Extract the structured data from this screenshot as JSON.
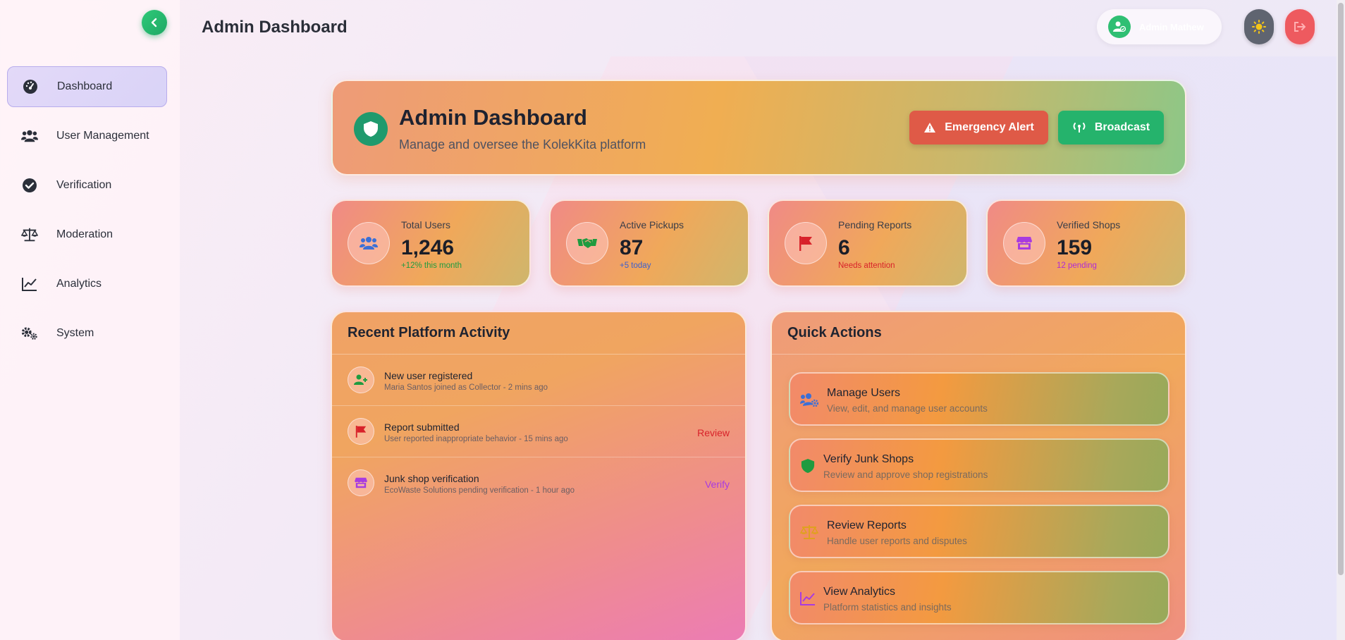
{
  "header": {
    "title": "Admin Dashboard",
    "user_name": "Admin Mathew"
  },
  "sidebar": {
    "items": [
      {
        "label": "Dashboard",
        "icon": "dashboard-gauge-icon",
        "active": true
      },
      {
        "label": "User Management",
        "icon": "users-icon",
        "active": false
      },
      {
        "label": "Verification",
        "icon": "check-circle-icon",
        "active": false
      },
      {
        "label": "Moderation",
        "icon": "balance-scale-icon",
        "active": false
      },
      {
        "label": "Analytics",
        "icon": "line-chart-icon",
        "active": false
      },
      {
        "label": "System",
        "icon": "gears-icon",
        "active": false
      }
    ]
  },
  "hero": {
    "title": "Admin Dashboard",
    "subtitle": "Manage and oversee the KolekKita platform",
    "emergency_label": "Emergency Alert",
    "broadcast_label": "Broadcast"
  },
  "stats": [
    {
      "label": "Total Users",
      "value": "1,246",
      "note": "+12% this month",
      "note_color": "#1f9b3f",
      "icon": "users-icon",
      "icon_color": "#3b6fd6"
    },
    {
      "label": "Active Pickups",
      "value": "87",
      "note": "+5 today",
      "note_color": "#3b5fd0",
      "icon": "handshake-icon",
      "icon_color": "#1f9b3f"
    },
    {
      "label": "Pending Reports",
      "value": "6",
      "note": "Needs attention",
      "note_color": "#d8222a",
      "icon": "flag-icon",
      "icon_color": "#d8222a"
    },
    {
      "label": "Verified Shops",
      "value": "159",
      "note": "12 pending",
      "note_color": "#b02ad6",
      "icon": "store-icon",
      "icon_color": "#a83be0"
    }
  ],
  "activity": {
    "title": "Recent Platform Activity",
    "items": [
      {
        "title": "New user registered",
        "desc": "Maria Santos joined as Collector - 2 mins ago",
        "icon": "user-plus-icon",
        "icon_color": "#1f9b3f",
        "action": "",
        "action_color": ""
      },
      {
        "title": "Report submitted",
        "desc": "User reported inappropriate behavior - 15 mins ago",
        "icon": "flag-icon",
        "icon_color": "#d8222a",
        "action": "Review",
        "action_color": "#d8222a"
      },
      {
        "title": "Junk shop verification",
        "desc": "EcoWaste Solutions pending verification - 1 hour ago",
        "icon": "store-icon",
        "icon_color": "#a83be0",
        "action": "Verify",
        "action_color": "#a83be0"
      }
    ]
  },
  "quick_actions": {
    "title": "Quick Actions",
    "items": [
      {
        "title": "Manage Users",
        "desc": "View, edit, and manage user accounts",
        "icon": "users-cog-icon",
        "icon_color": "#3b6fd6"
      },
      {
        "title": "Verify Junk Shops",
        "desc": "Review and approve shop registrations",
        "icon": "shield-icon",
        "icon_color": "#1f9b3f"
      },
      {
        "title": "Review Reports",
        "desc": "Handle user reports and disputes",
        "icon": "balance-scale-icon",
        "icon_color": "#e0a020"
      },
      {
        "title": "View Analytics",
        "desc": "Platform statistics and insights",
        "icon": "line-chart-icon",
        "icon_color": "#a83be0"
      }
    ]
  },
  "colors": {
    "accent_green": "#25b36c",
    "danger_red": "#df5a47",
    "active_nav_bg": "#e3d9f8"
  }
}
